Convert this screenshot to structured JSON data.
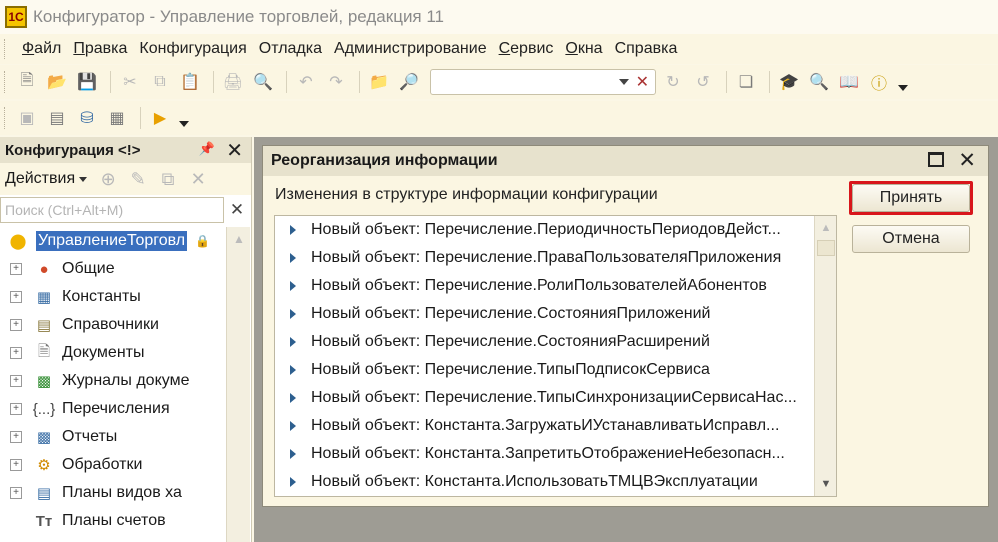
{
  "window": {
    "title": "Конфигуратор - Управление торговлей, редакция 11",
    "icon": "1c-logo-icon"
  },
  "menu": [
    {
      "label": "Файл",
      "accel": "Ф"
    },
    {
      "label": "Правка",
      "accel": "П"
    },
    {
      "label": "Конфигурация",
      "accel": ""
    },
    {
      "label": "Отладка",
      "accel": ""
    },
    {
      "label": "Администрирование",
      "accel": ""
    },
    {
      "label": "Сервис",
      "accel": "С"
    },
    {
      "label": "Окна",
      "accel": "О"
    },
    {
      "label": "Справка",
      "accel": ""
    }
  ],
  "toolbar": {
    "search_value": ""
  },
  "left_panel": {
    "title": "Конфигурация <!>",
    "actions_label": "Действия",
    "search_placeholder": "Поиск (Ctrl+Alt+M)",
    "root_label": "УправлениеТорговл",
    "items": [
      {
        "label": "Общие",
        "icon": "general-icon"
      },
      {
        "label": "Константы",
        "icon": "constants-icon"
      },
      {
        "label": "Справочники",
        "icon": "catalogs-icon"
      },
      {
        "label": "Документы",
        "icon": "documents-icon"
      },
      {
        "label": "Журналы докуме",
        "icon": "journals-icon"
      },
      {
        "label": "Перечисления",
        "icon": "enums-icon"
      },
      {
        "label": "Отчеты",
        "icon": "reports-icon"
      },
      {
        "label": "Обработки",
        "icon": "processing-icon"
      },
      {
        "label": "Планы видов ха",
        "icon": "char-plans-icon"
      },
      {
        "label": "Планы счетов",
        "icon": "accounts-icon"
      }
    ]
  },
  "dialog": {
    "title": "Реорганизация информации",
    "subtitle": "Изменения в структуре информации конфигурации",
    "accept_label": "Принять",
    "cancel_label": "Отмена",
    "changes": [
      "Новый объект: Перечисление.ПериодичностьПериодовДейст...",
      "Новый объект: Перечисление.ПраваПользователяПриложения",
      "Новый объект: Перечисление.РолиПользователейАбонентов",
      "Новый объект: Перечисление.СостоянияПриложений",
      "Новый объект: Перечисление.СостоянияРасширений",
      "Новый объект: Перечисление.ТипыПодписокСервиса",
      "Новый объект: Перечисление.ТипыСинхронизацииСервисаНас...",
      "Новый объект: Константа.ЗагружатьИУстанавливатьИсправл...",
      "Новый объект: Константа.ЗапретитьОтображениеНебезопасн...",
      "Новый объект: Константа.ИспользоватьТМЦВЭксплуатации"
    ]
  },
  "colors": {
    "highlight_border": "#d8161b",
    "selection": "#3a6fbe"
  }
}
